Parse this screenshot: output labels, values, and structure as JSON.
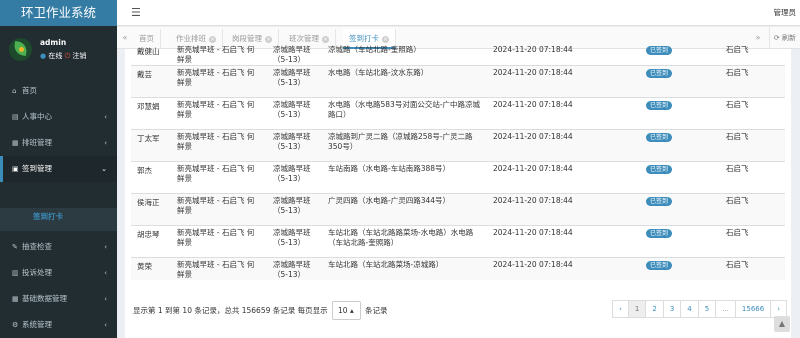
{
  "app": {
    "title": "环卫作业系统"
  },
  "user": {
    "name": "admin",
    "status": "在线",
    "logout": "注销"
  },
  "header": {
    "admin_label": "管理员"
  },
  "sidebar": {
    "items": [
      {
        "icon": "home-icon",
        "glyph": "⌂",
        "label": "首页",
        "arrow": ""
      },
      {
        "icon": "id-card-icon",
        "glyph": "▤",
        "label": "人事中心",
        "arrow": "‹"
      },
      {
        "icon": "schedule-icon",
        "glyph": "▦",
        "label": "排班管理",
        "arrow": "‹"
      },
      {
        "icon": "calendar-icon",
        "glyph": "▣",
        "label": "签到管理",
        "arrow": "⌄"
      },
      {
        "icon": "list-icon",
        "glyph": "☰",
        "label": "作业管理",
        "arrow": "‹"
      },
      {
        "icon": "wrench-icon",
        "glyph": "✎",
        "label": "抽查检查",
        "arrow": "‹"
      },
      {
        "icon": "complaint-icon",
        "glyph": "▥",
        "label": "投诉处理",
        "arrow": "‹"
      },
      {
        "icon": "data-icon",
        "glyph": "▦",
        "label": "基础数据管理",
        "arrow": "‹"
      },
      {
        "icon": "gear-icon",
        "glyph": "⚙",
        "label": "系统管理",
        "arrow": "‹"
      }
    ],
    "submenu": "签到打卡"
  },
  "tabs": {
    "items": [
      "首页",
      "作业排班",
      "岗段管理",
      "班次管理",
      "签到打卡"
    ],
    "refresh": "刷新"
  },
  "table": {
    "rows": [
      {
        "name": "戴健山",
        "shift": "新亮城早班 - 石启飞 何鲜景",
        "time": "凉城路早班（5-13）",
        "road": "凉城路（车站北路-奎照路）",
        "date": "2024-11-20 07:18:44",
        "status": "已签到",
        "manager": "石启飞"
      },
      {
        "name": "戴芸",
        "shift": "新亮城早班 - 石启飞 何鲜景",
        "time": "凉城路早班（5-13）",
        "road": "水电路（车站北路-汶水东路）",
        "date": "2024-11-20 07:18:44",
        "status": "已签到",
        "manager": "石启飞"
      },
      {
        "name": "邓慧娟",
        "shift": "新亮城早班 - 石启飞 何鲜景",
        "time": "凉城路早班（5-13）",
        "road": "水电路（水电路583号对面公交站-广中路凉城路口）",
        "date": "2024-11-20 07:18:44",
        "status": "已签到",
        "manager": "石启飞"
      },
      {
        "name": "丁太军",
        "shift": "新亮城早班 - 石启飞 何鲜景",
        "time": "凉城路早班（5-13）",
        "road": "凉城路到广灵二路（凉城路258号-广灵二路350号）",
        "date": "2024-11-20 07:18:44",
        "status": "已签到",
        "manager": "石启飞"
      },
      {
        "name": "郭杰",
        "shift": "新亮城早班 - 石启飞 何鲜景",
        "time": "凉城路早班（5-13）",
        "road": "车站南路（水电路-车站南路388号）",
        "date": "2024-11-20 07:18:44",
        "status": "已签到",
        "manager": "石启飞"
      },
      {
        "name": "侯海正",
        "shift": "新亮城早班 - 石启飞 何鲜景",
        "time": "凉城路早班（5-13）",
        "road": "广灵四路（水电路-广灵四路344号）",
        "date": "2024-11-20 07:18:44",
        "status": "已签到",
        "manager": "石启飞"
      },
      {
        "name": "胡忠琴",
        "shift": "新亮城早班 - 石启飞 何鲜景",
        "time": "凉城路早班（5-13）",
        "road": "车站北路（车站北路路菜场-水电路）水电路（车站北路-奎照路）",
        "date": "2024-11-20 07:18:44",
        "status": "已签到",
        "manager": "石启飞"
      },
      {
        "name": "黄荣",
        "shift": "新亮城早班 - 石启飞 何鲜景",
        "time": "凉城路早班（5-13）",
        "road": "车站北路（车站北路菜场-凉城路）",
        "date": "2024-11-20 07:18:44",
        "status": "已签到",
        "manager": "石启飞"
      }
    ]
  },
  "footer": {
    "info": "显示第 1 到第 10 条记录，总共 156659 条记录  每页显示",
    "page_size": "10",
    "after_size": "条记录",
    "pages": [
      "‹",
      "1",
      "2",
      "3",
      "4",
      "5",
      "...",
      "15666",
      "›"
    ]
  },
  "colors": {
    "accent": "#3c8dbc",
    "sidebar": "#222d32",
    "logo_bg": "#357ca5"
  }
}
